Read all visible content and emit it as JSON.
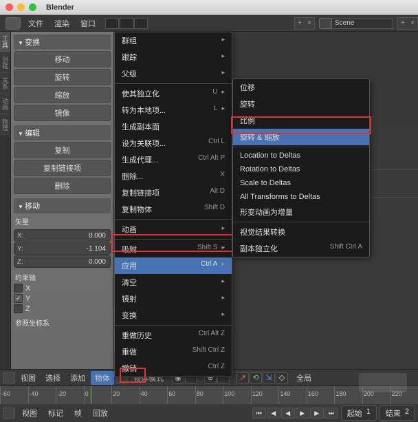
{
  "title": "Blender",
  "topmenu": {
    "file": "文件",
    "render": "渲染",
    "window": "窗口",
    "scene": "Scene"
  },
  "leftrail": {
    "tools": "工具",
    "create": "创建",
    "relations": "关系",
    "anim": "动画",
    "physics": "物理"
  },
  "panel": {
    "transform": {
      "header": "变换",
      "translate": "移动",
      "rotate": "旋转",
      "scale": "缩放",
      "mirror": "镜像"
    },
    "edit": {
      "header": "编辑",
      "duplicate": "复制",
      "duplink": "复制链接项",
      "delete": "删除"
    },
    "move": {
      "header": "移动",
      "vector": "矢量",
      "x": "X:",
      "xval": "0.000",
      "y": "Y:",
      "yval": "-1.104",
      "z": "Z:",
      "zval": "0.000"
    },
    "axis": {
      "header": "约束轴",
      "x": "X",
      "y": "Y",
      "z": "Z"
    },
    "coord": "参照坐标系"
  },
  "menu1": {
    "group": "群组",
    "track": "跟踪",
    "parent": "父级",
    "independent": "使其独立化",
    "independentsc": "U",
    "local": "转为本地项...",
    "localsc": "L",
    "proxy": "生成副本面",
    "setrel": "设为关联项...",
    "setrelsc": "Ctrl L",
    "dupli": "生成代理...",
    "duplisc": "Ctrl Alt P",
    "delete": "删除...",
    "deletesc": "X",
    "duplink": "复制链接项",
    "duplinksc": "Alt D",
    "dupobj": "复制物体",
    "dupobjsc": "Shift D",
    "anim": "动画",
    "snap": "吸附",
    "snapsc": "Shift S",
    "apply": "应用",
    "applysc": "Ctrl A",
    "clear": "清空",
    "mirror": "镜射",
    "transform": "变换",
    "undohist": "重做历史",
    "undohistsc": "Ctrl Alt Z",
    "redo": "重做",
    "redosc": "Shift Ctrl Z",
    "undo": "撤销",
    "undosc": "Ctrl Z"
  },
  "menu2": {
    "loc": "位移",
    "rot": "旋转",
    "scale": "比例",
    "rotscale": "旋转 & 缩放",
    "locdelta": "Location to Deltas",
    "rotdelta": "Rotation to Deltas",
    "scaledelta": "Scale to Deltas",
    "alldelta": "All Transforms to Deltas",
    "animdelta": "形变动画为增量",
    "visual": "视觉结果转换",
    "dupreal": "副本独立化",
    "duprealsc": "Shift Ctrl A"
  },
  "bottom": {
    "view": "视图",
    "select": "选择",
    "add": "添加",
    "object": "物体",
    "objmode": "物体模式",
    "global": "全局"
  },
  "timeline": {
    "ticks": [
      -60,
      -40,
      -20,
      0,
      20,
      40,
      60,
      80,
      100,
      120,
      140,
      160,
      180,
      200,
      220
    ],
    "view": "视图",
    "marker": "标记",
    "frame": "帧",
    "playback": "回放",
    "start": "起始",
    "startval": "1",
    "end": "结束",
    "endval": "2"
  },
  "chart_data": {
    "type": "timeline",
    "start": 1,
    "end": 2,
    "visible_range": [
      -60,
      230
    ],
    "current": 1
  }
}
